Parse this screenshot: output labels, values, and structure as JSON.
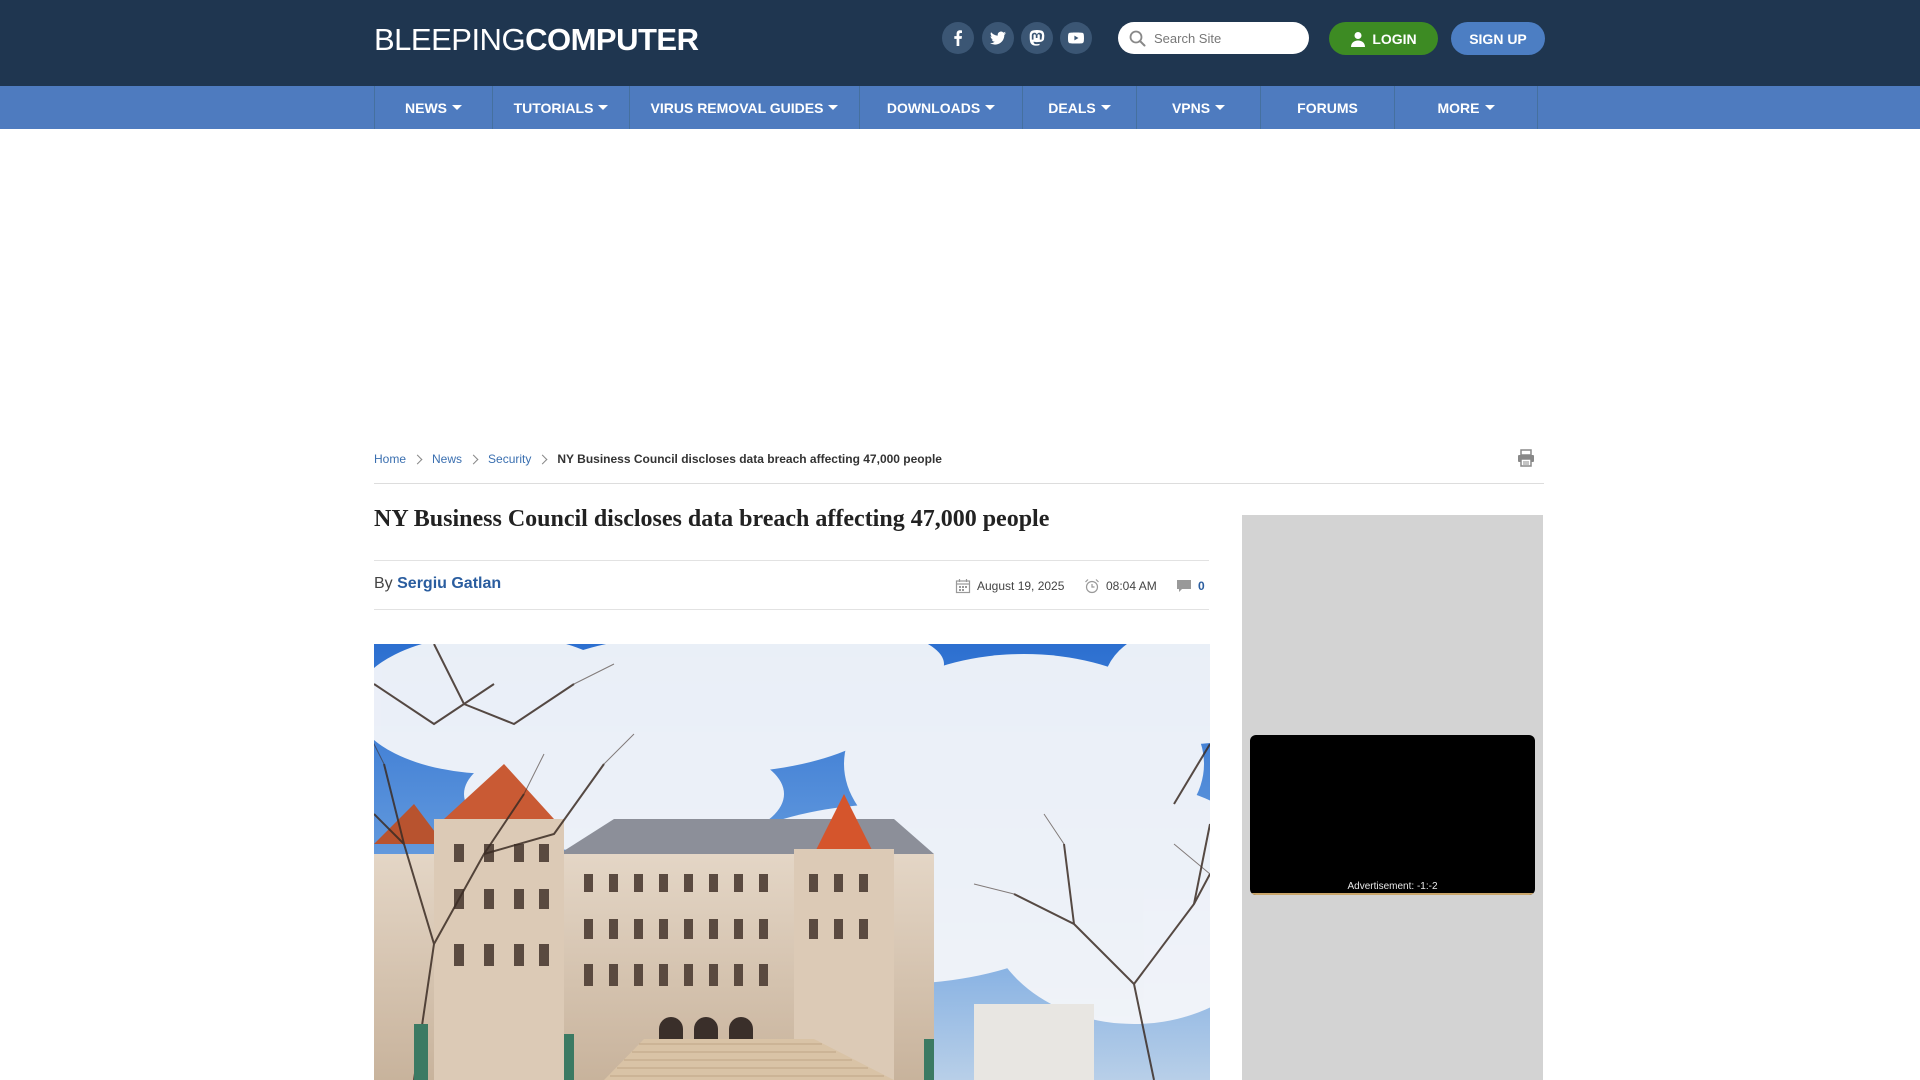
{
  "header": {
    "logo_thin": "BLEEPING",
    "logo_bold": "COMPUTER",
    "social": [
      {
        "name": "facebook-icon"
      },
      {
        "name": "twitter-icon"
      },
      {
        "name": "mastodon-icon"
      },
      {
        "name": "youtube-icon"
      }
    ],
    "search_placeholder": "Search Site",
    "login_label": "LOGIN",
    "signup_label": "SIGN UP"
  },
  "nav": {
    "items": [
      {
        "label": "NEWS",
        "dropdown": true
      },
      {
        "label": "TUTORIALS",
        "dropdown": true
      },
      {
        "label": "VIRUS REMOVAL GUIDES",
        "dropdown": true
      },
      {
        "label": "DOWNLOADS",
        "dropdown": true
      },
      {
        "label": "DEALS",
        "dropdown": true
      },
      {
        "label": "VPNS",
        "dropdown": true
      },
      {
        "label": "FORUMS",
        "dropdown": false
      },
      {
        "label": "MORE",
        "dropdown": true
      }
    ]
  },
  "breadcrumb": {
    "items": [
      "Home",
      "News",
      "Security"
    ],
    "current": "NY Business Council discloses data breach affecting 47,000 people"
  },
  "article": {
    "title": "NY Business Council discloses data breach affecting 47,000 people",
    "by_prefix": "By",
    "author": "Sergiu Gatlan",
    "date": "August 19, 2025",
    "time": "08:04 AM",
    "comments": "0"
  },
  "sidebar": {
    "ad_label": "Advertisement: -1:-2"
  },
  "colors": {
    "header_bg": "#1f3650",
    "nav_bg": "#4e7bbf",
    "login_green": "#3d8b23",
    "signup_blue": "#4c7ec3",
    "link_blue": "#2a5d9f"
  }
}
